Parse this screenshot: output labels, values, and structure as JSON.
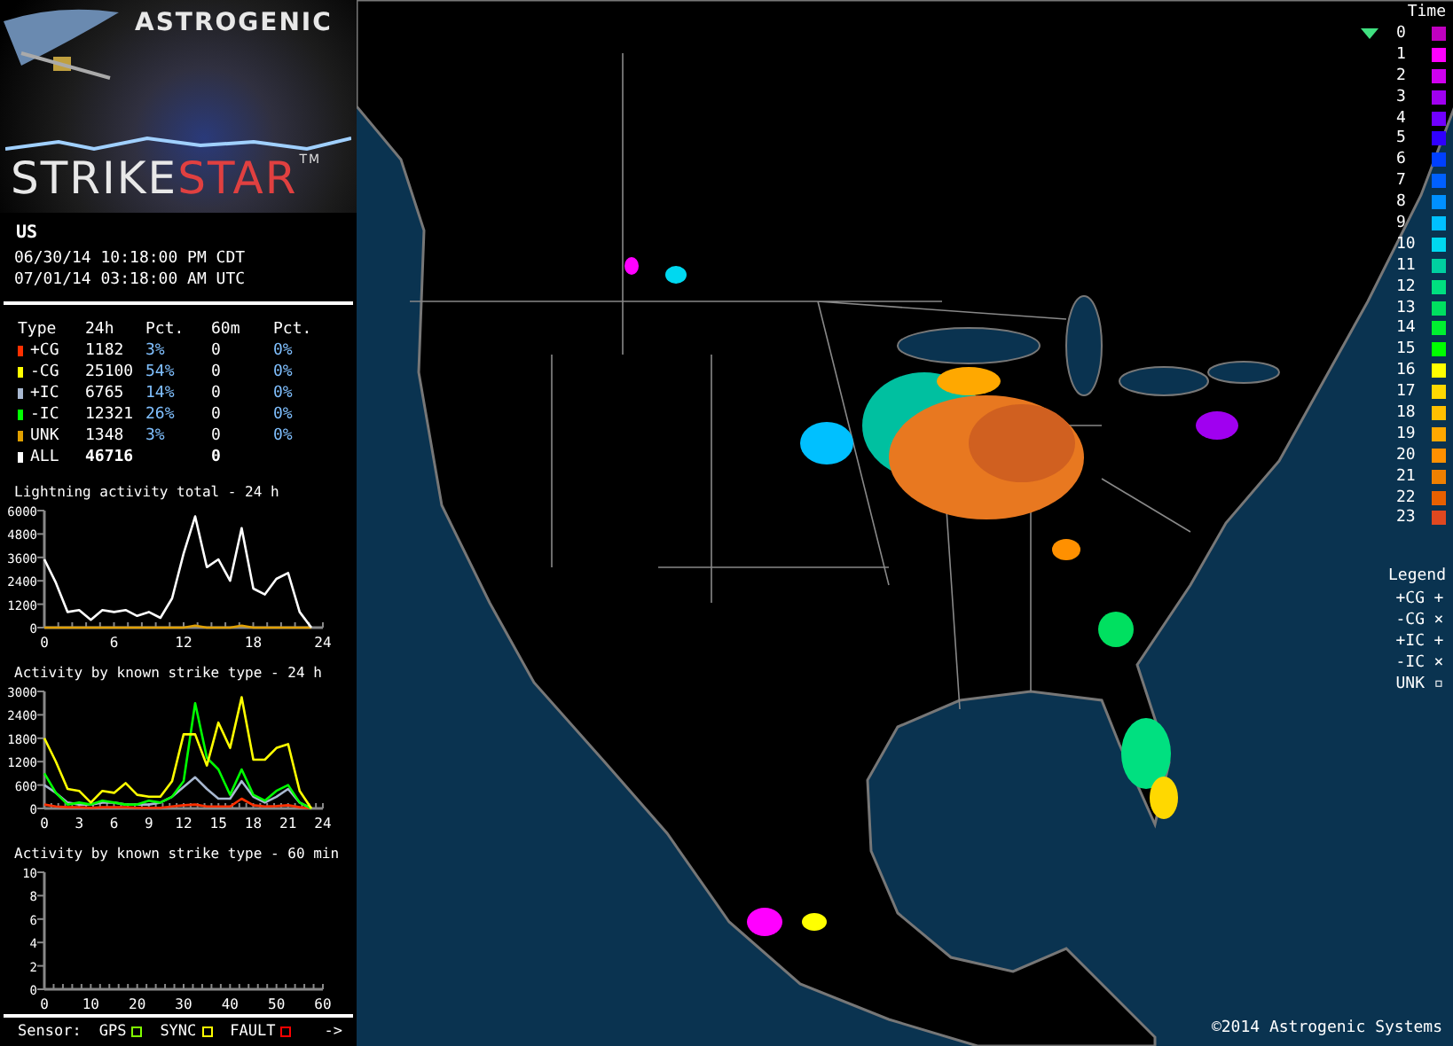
{
  "logo": {
    "brand": "ASTROGENIC",
    "product_left": "STRIKE",
    "product_right": "STAR",
    "trademark": "TM"
  },
  "region": "US",
  "times": [
    "06/30/14 10:18:00 PM CDT",
    "07/01/14 03:18:00 AM UTC"
  ],
  "stats": {
    "columns": [
      "Type",
      "24h",
      "Pct.",
      "60m",
      "Pct."
    ],
    "rows": [
      {
        "type": "+CG",
        "day": "1182",
        "day_pct": "3%",
        "hour": "0",
        "hour_pct": "0%",
        "color": "#ff3000",
        "total": false
      },
      {
        "type": "-CG",
        "day": "25100",
        "day_pct": "54%",
        "hour": "0",
        "hour_pct": "0%",
        "color": "#ffff00",
        "total": false
      },
      {
        "type": "+IC",
        "day": "6765",
        "day_pct": "14%",
        "hour": "0",
        "hour_pct": "0%",
        "color": "#a8b8d0",
        "total": false
      },
      {
        "type": "-IC",
        "day": "12321",
        "day_pct": "26%",
        "hour": "0",
        "hour_pct": "0%",
        "color": "#00ff00",
        "total": false
      },
      {
        "type": "UNK",
        "day": "1348",
        "day_pct": "3%",
        "hour": "0",
        "hour_pct": "0%",
        "color": "#e0a000",
        "total": false
      },
      {
        "type": "ALL",
        "day": "46716",
        "hour": "0",
        "color": "#ffffff",
        "total": true
      }
    ]
  },
  "charts": [
    {
      "chart_data": {
        "type": "line",
        "title": "Lightning activity total - 24 h",
        "x": [
          0,
          1,
          2,
          3,
          4,
          5,
          6,
          7,
          8,
          9,
          10,
          11,
          12,
          13,
          14,
          15,
          16,
          17,
          18,
          19,
          20,
          21,
          22,
          23
        ],
        "xlim": [
          0,
          24
        ],
        "ylim": [
          0,
          6000
        ],
        "xticks": [
          0,
          6,
          12,
          18,
          24
        ],
        "yticks": [
          0,
          1200,
          2400,
          3600,
          4800,
          6000
        ],
        "series": [
          {
            "color": "#ffffff",
            "values": [
              3500,
              2300,
              800,
              900,
              400,
              900,
              800,
              900,
              600,
              800,
              500,
              1500,
              3800,
              5700,
              3100,
              3500,
              2400,
              5100,
              2000,
              1700,
              2500,
              2800,
              800,
              0
            ]
          },
          {
            "color": "#e0a000",
            "values": [
              0,
              0,
              0,
              0,
              0,
              0,
              0,
              0,
              0,
              0,
              0,
              0,
              0,
              100,
              0,
              0,
              0,
              100,
              0,
              0,
              0,
              0,
              0,
              0
            ]
          }
        ]
      }
    },
    {
      "chart_data": {
        "type": "line",
        "title": "Activity by known strike type - 24 h",
        "x": [
          0,
          1,
          2,
          3,
          4,
          5,
          6,
          7,
          8,
          9,
          10,
          11,
          12,
          13,
          14,
          15,
          16,
          17,
          18,
          19,
          20,
          21,
          22,
          23
        ],
        "xlim": [
          0,
          24
        ],
        "ylim": [
          0,
          3000
        ],
        "xticks": [
          0,
          3,
          6,
          9,
          12,
          15,
          18,
          21,
          24
        ],
        "yticks": [
          0,
          600,
          1200,
          1800,
          2400,
          3000
        ],
        "series": [
          {
            "color": "#ffff00",
            "values": [
              1800,
              1200,
              500,
              450,
              150,
              450,
              400,
              650,
              350,
              300,
              300,
              700,
              1900,
              1900,
              1100,
              2200,
              1550,
              2850,
              1250,
              1250,
              1550,
              1650,
              450,
              0
            ]
          },
          {
            "color": "#00ff00",
            "values": [
              900,
              400,
              100,
              150,
              100,
              200,
              150,
              100,
              100,
              200,
              150,
              300,
              700,
              2700,
              1300,
              1000,
              350,
              1000,
              350,
              200,
              450,
              600,
              150,
              0
            ]
          },
          {
            "color": "#a8b8d0",
            "values": [
              600,
              400,
              150,
              100,
              100,
              150,
              150,
              100,
              100,
              100,
              150,
              300,
              550,
              800,
              500,
              250,
              250,
              700,
              300,
              150,
              300,
              500,
              150,
              0
            ]
          },
          {
            "color": "#ff3000",
            "values": [
              100,
              50,
              30,
              30,
              20,
              30,
              30,
              30,
              20,
              20,
              20,
              50,
              80,
              100,
              50,
              50,
              50,
              250,
              80,
              50,
              60,
              80,
              30,
              0
            ]
          }
        ]
      }
    },
    {
      "chart_data": {
        "type": "line",
        "title": "Activity by known strike type - 60 min",
        "xlim": [
          0,
          60
        ],
        "ylim": [
          0,
          10
        ],
        "xticks": [
          0,
          10,
          20,
          30,
          40,
          50,
          60
        ],
        "yticks": [
          0,
          2,
          4,
          6,
          8,
          10
        ]
      }
    }
  ],
  "sensor": {
    "label": "Sensor:",
    "indicators": [
      {
        "label": "GPS",
        "color": "#80ff00"
      },
      {
        "label": "SYNC",
        "color": "#ffff00"
      },
      {
        "label": "FAULT",
        "color": "#ff0000"
      }
    ],
    "next": "->"
  },
  "time_legend": {
    "title": "Time",
    "items": [
      {
        "label": "0",
        "color": "#c000c0",
        "selected": true
      },
      {
        "label": "1",
        "color": "#ff00ff",
        "selected": false
      },
      {
        "label": "2",
        "color": "#d000f0",
        "selected": false
      },
      {
        "label": "3",
        "color": "#a000f0",
        "selected": false
      },
      {
        "label": "4",
        "color": "#7000ff",
        "selected": false
      },
      {
        "label": "5",
        "color": "#3000ff",
        "selected": false
      },
      {
        "label": "6",
        "color": "#0040ff",
        "selected": false
      },
      {
        "label": "7",
        "color": "#0060ff",
        "selected": false
      },
      {
        "label": "8",
        "color": "#0090ff",
        "selected": false
      },
      {
        "label": "9",
        "color": "#00c0ff",
        "selected": false
      },
      {
        "label": "10",
        "color": "#00d8f0",
        "selected": false
      },
      {
        "label": "11",
        "color": "#00d0a0",
        "selected": false
      },
      {
        "label": "12",
        "color": "#00e080",
        "selected": false
      },
      {
        "label": "13",
        "color": "#00e060",
        "selected": false
      },
      {
        "label": "14",
        "color": "#00f030",
        "selected": false
      },
      {
        "label": "15",
        "color": "#00ff00",
        "selected": false
      },
      {
        "label": "16",
        "color": "#ffff00",
        "selected": false
      },
      {
        "label": "17",
        "color": "#ffd800",
        "selected": false
      },
      {
        "label": "18",
        "color": "#ffc000",
        "selected": false
      },
      {
        "label": "19",
        "color": "#ffa800",
        "selected": false
      },
      {
        "label": "20",
        "color": "#ff9000",
        "selected": false
      },
      {
        "label": "21",
        "color": "#f08000",
        "selected": false
      },
      {
        "label": "22",
        "color": "#e86000",
        "selected": false
      },
      {
        "label": "23",
        "color": "#e04820",
        "selected": false
      }
    ]
  },
  "type_legend": {
    "title": "Legend",
    "items": [
      {
        "label": "+CG",
        "symbol": "+"
      },
      {
        "label": "-CG",
        "symbol": "×"
      },
      {
        "label": "+IC",
        "symbol": "+"
      },
      {
        "label": "-IC",
        "symbol": "×"
      },
      {
        "label": "UNK",
        "symbol": "▫"
      }
    ]
  },
  "copyright": "©2014 Astrogenic Systems"
}
